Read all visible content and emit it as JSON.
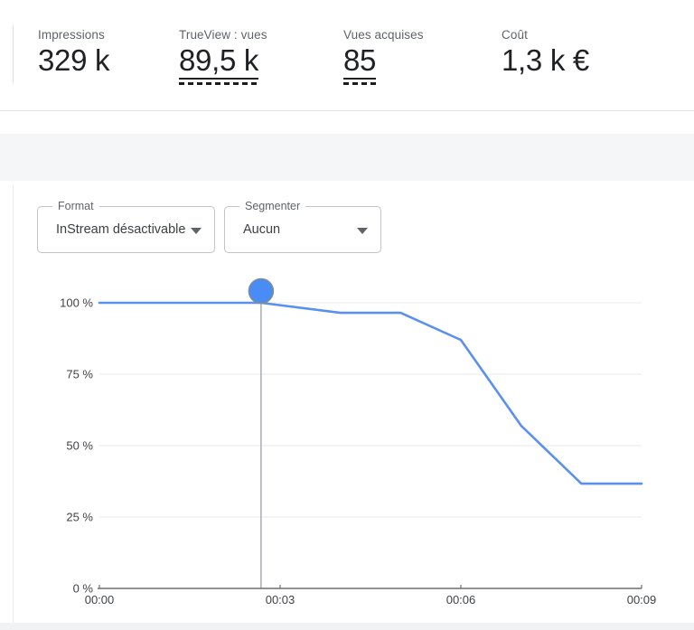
{
  "metrics": [
    {
      "label": "Impressions",
      "value": "329 k",
      "underlined": false
    },
    {
      "label": "TrueView : vues",
      "value": "89,5 k",
      "underlined": true
    },
    {
      "label": "Vues acquises",
      "value": "85",
      "underlined": true
    },
    {
      "label": "Coût",
      "value": "1,3 k €",
      "underlined": false
    }
  ],
  "filters": {
    "format": {
      "label": "Format",
      "value": "InStream désactivable"
    },
    "segment": {
      "label": "Segmenter",
      "value": "Aucun"
    }
  },
  "chart_data": {
    "type": "line",
    "xlabel": "",
    "ylabel": "",
    "ylim": [
      0,
      100
    ],
    "xlim_seconds": [
      0,
      540
    ],
    "grid": true,
    "legend": "none",
    "yticks": [
      {
        "label": "100 %",
        "value": 100
      },
      {
        "label": "75 %",
        "value": 75
      },
      {
        "label": "50 %",
        "value": 50
      },
      {
        "label": "25 %",
        "value": 25
      },
      {
        "label": "0 %",
        "value": 0
      }
    ],
    "xticks": [
      {
        "label": "00:00",
        "seconds": 0
      },
      {
        "label": "00:03",
        "seconds": 180
      },
      {
        "label": "00:06",
        "seconds": 360
      },
      {
        "label": "00:09",
        "seconds": 540
      }
    ],
    "points": [
      {
        "time": "00:00",
        "seconds": 0,
        "value": 100
      },
      {
        "time": "02:41",
        "seconds": 161,
        "value": 100
      },
      {
        "time": "04:00",
        "seconds": 240,
        "value": 96.5
      },
      {
        "time": "05:00",
        "seconds": 300,
        "value": 96.5
      },
      {
        "time": "06:00",
        "seconds": 360,
        "value": 87
      },
      {
        "time": "07:00",
        "seconds": 420,
        "value": 57
      },
      {
        "time": "08:00",
        "seconds": 480,
        "value": 36.7
      },
      {
        "time": "09:00",
        "seconds": 540,
        "value": 36.7
      }
    ],
    "highlight": {
      "time": "02:41",
      "seconds": 161,
      "value": 100
    },
    "colors": {
      "line": "#5b90ee",
      "marker_fill": "#4a8cf5",
      "marker_stroke": "#7f8c98",
      "grid": "#e9e9e9",
      "axis": "#6e6e6e",
      "crosshair": "#9aa0a6"
    }
  }
}
